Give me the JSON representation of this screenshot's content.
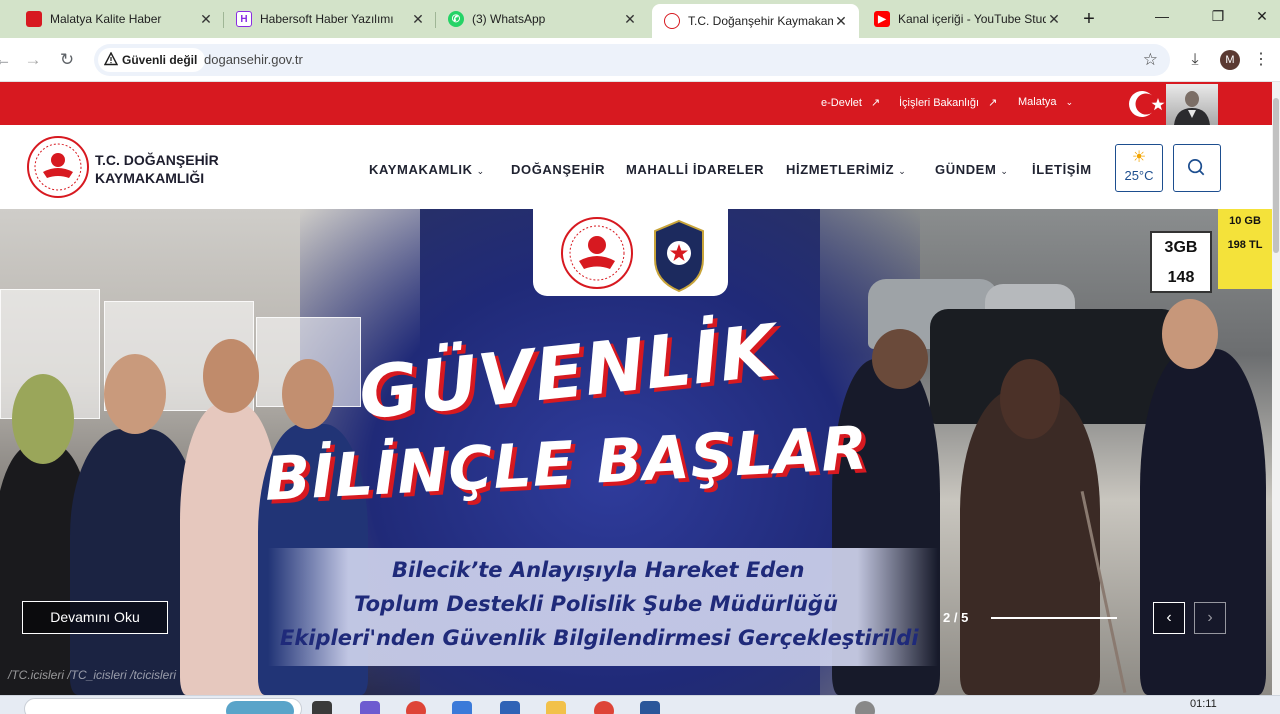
{
  "browser": {
    "tabs": [
      {
        "title": "Malatya Kalite Haber",
        "favicon_color": "#d71920",
        "active": false
      },
      {
        "title": "Habersoft Haber Yazılımı",
        "favicon_color": "#8a2be2",
        "active": false
      },
      {
        "title": "(3) WhatsApp",
        "favicon_color": "#25d366",
        "active": false
      },
      {
        "title": "T.C. Doğanşehir Kaymakaml",
        "favicon_color": "#d71920",
        "active": true
      },
      {
        "title": "Kanal içeriği - YouTube Studi",
        "favicon_color": "#ff0000",
        "active": false
      }
    ],
    "security_label": "Güvenli değil",
    "url": "dogansehir.gov.tr",
    "profile_initial": "M"
  },
  "topbar": {
    "links": [
      {
        "label": "e-Devlet",
        "icon": "external-arrow-icon"
      },
      {
        "label": "İçişleri Bakanlığı",
        "icon": "external-arrow-icon"
      },
      {
        "label": "Malatya",
        "icon": "chevron-down-icon"
      }
    ],
    "accent": "#d71920"
  },
  "header": {
    "brand_line1": "T.C. DOĞANŞEHİR",
    "brand_line2": "KAYMAKAMLIĞI",
    "nav": [
      {
        "label": "KAYMAKAMLIK",
        "dropdown": true
      },
      {
        "label": "DOĞANŞEHİR",
        "dropdown": false
      },
      {
        "label": "MAHALLİ İDARELER",
        "dropdown": false
      },
      {
        "label": "HİZMETLERİMİZ",
        "dropdown": true
      },
      {
        "label": "GÜNDEM",
        "dropdown": true
      },
      {
        "label": "İLETİŞİM",
        "dropdown": false
      }
    ],
    "weather": {
      "icon": "sun-icon",
      "temperature": "25°C"
    }
  },
  "slider": {
    "headline_line1": "GÜVENLİK",
    "headline_line2": "BİLİNÇLE BAŞLAR",
    "sub_lines": [
      "Bilecik’te Anlayışıyla Hareket Eden",
      "Toplum Destekli Polislik Şube Müdürlüğü",
      "Ekipleri'nden Güvenlik Bilgilendirmesi Gerçekleştirildi"
    ],
    "read_more_label": "Devamını Oku",
    "counter": "2 / 5",
    "social": "/TC.icisleri   /TC_icisleri   /tcicisleri",
    "brand_blue": "#1f2a7a"
  },
  "taskbar": {
    "clock": "01:11"
  }
}
